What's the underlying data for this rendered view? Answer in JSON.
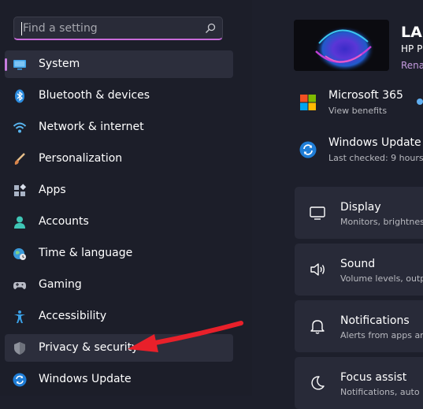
{
  "search": {
    "placeholder": "Find a setting",
    "icon": "search-icon"
  },
  "sidebar": {
    "items": [
      {
        "label": "System",
        "icon": "monitor-icon",
        "selected": true
      },
      {
        "label": "Bluetooth & devices",
        "icon": "bluetooth-icon"
      },
      {
        "label": "Network & internet",
        "icon": "wifi-icon"
      },
      {
        "label": "Personalization",
        "icon": "brush-icon"
      },
      {
        "label": "Apps",
        "icon": "apps-icon"
      },
      {
        "label": "Accounts",
        "icon": "person-icon"
      },
      {
        "label": "Time & language",
        "icon": "globe-clock-icon"
      },
      {
        "label": "Gaming",
        "icon": "gamepad-icon"
      },
      {
        "label": "Accessibility",
        "icon": "accessibility-icon"
      },
      {
        "label": "Privacy & security",
        "icon": "shield-icon"
      },
      {
        "label": "Windows Update",
        "icon": "update-icon"
      }
    ]
  },
  "account": {
    "name": "LAF",
    "model": "HP P",
    "rename": "Rena"
  },
  "quick_links": [
    {
      "title": "Microsoft 365",
      "subtitle": "View benefits",
      "icon": "microsoft-logo-icon"
    },
    {
      "title": "Windows Update",
      "subtitle": "Last checked: 9 hours",
      "icon": "update-icon"
    }
  ],
  "cards": [
    {
      "title": "Display",
      "subtitle": "Monitors, brightnes",
      "icon": "display-icon"
    },
    {
      "title": "Sound",
      "subtitle": "Volume levels, outp",
      "icon": "speaker-icon"
    },
    {
      "title": "Notifications",
      "subtitle": "Alerts from apps an",
      "icon": "bell-icon"
    },
    {
      "title": "Focus assist",
      "subtitle": "Notifications, auto",
      "icon": "moon-icon"
    }
  ],
  "colors": {
    "background": "#1d1f2b",
    "accent": "#c77ce0",
    "arrow": "#e8202a",
    "card": "#282a38"
  }
}
